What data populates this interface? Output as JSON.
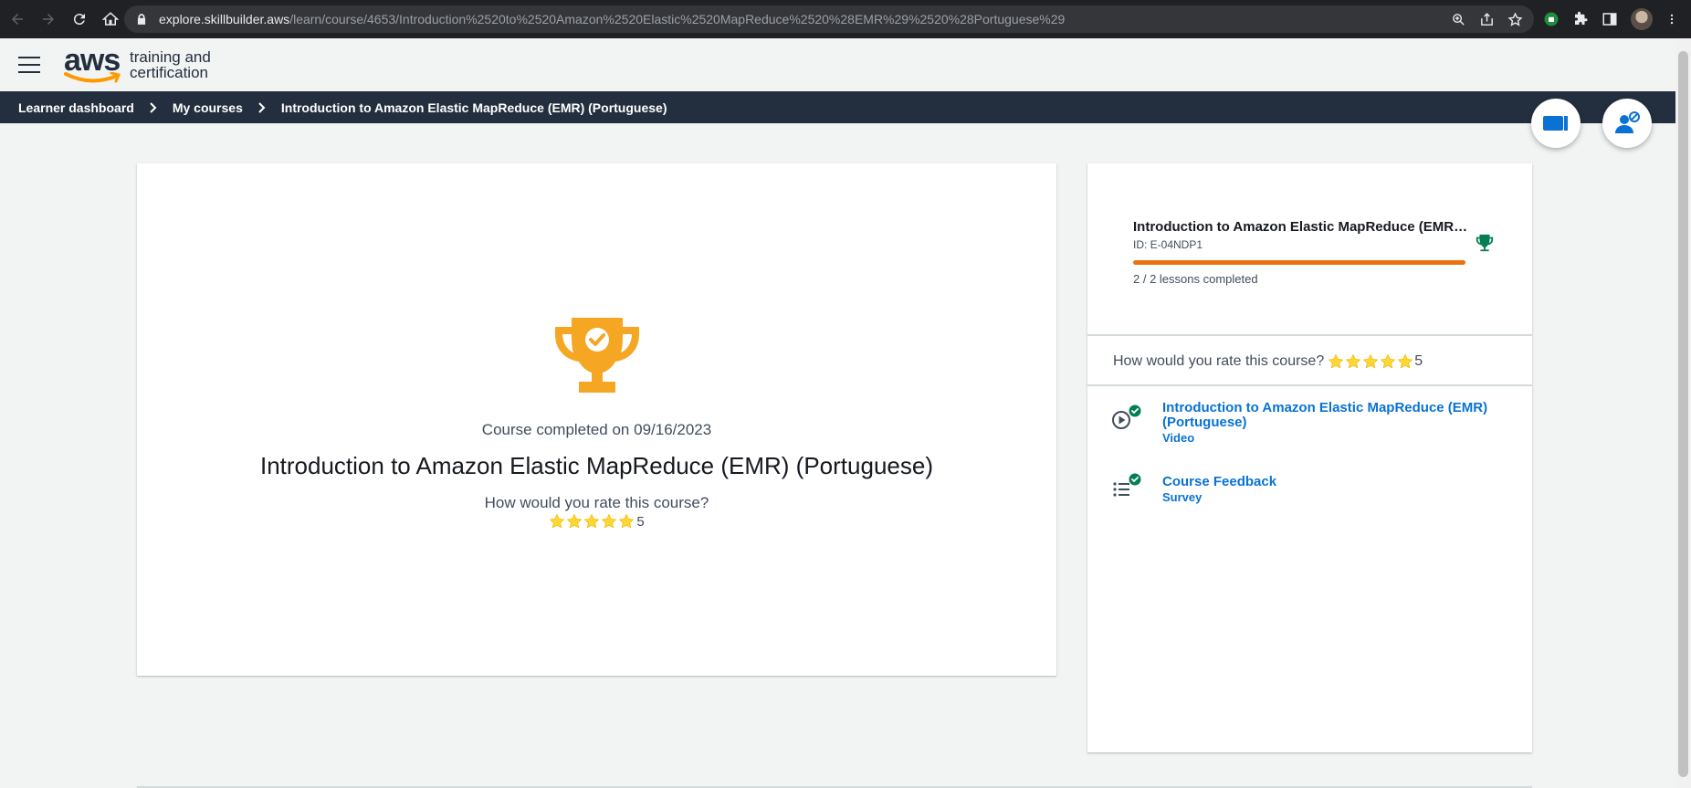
{
  "browser": {
    "url_host": "explore.skillbuilder.aws",
    "url_path": "/learn/course/4653/Introduction%2520to%2520Amazon%2520Elastic%2520MapReduce%2520%28EMR%29%2520%28Portuguese%29",
    "icons": [
      "back-icon",
      "forward-icon",
      "reload-icon",
      "home-icon",
      "lock-icon",
      "zoom-icon",
      "share-icon",
      "star-icon",
      "extension-icon",
      "puzzle-icon",
      "sidepanel-icon",
      "avatar",
      "more-icon"
    ]
  },
  "header": {
    "logo_word": "aws",
    "logo_line1": "training and",
    "logo_line2": "certification",
    "brand_color": "#232f3e",
    "smile_color": "#ff9900"
  },
  "breadcrumb": {
    "items": [
      "Learner dashboard",
      "My courses",
      "Introduction to Amazon Elastic MapReduce (EMR) (Portuguese)"
    ]
  },
  "fabs": [
    "video-icon",
    "accessibility-user-icon"
  ],
  "main": {
    "completed_on": "Course completed on 09/16/2023",
    "title": "Introduction to Amazon Elastic MapReduce (EMR) (Portuguese)",
    "rate_question": "How would you rate this course?",
    "stars": 5,
    "rating": "5",
    "trophy_color": "#f5a623"
  },
  "side": {
    "title": "Introduction to Amazon Elastic MapReduce (EMR) (Portuguese)",
    "course_id": "ID: E-04NDP1",
    "progress_fraction": 1.0,
    "progress_color": "#ec7211",
    "lessons_completed": "2 / 2 lessons completed",
    "rate_question": "How would you rate this course?",
    "rating": "5",
    "trophy_color": "#037f51",
    "lessons": [
      {
        "title": "Introduction to Amazon Elastic MapReduce (EMR) (Portuguese)",
        "type": "Video",
        "icon": "play-circle-icon",
        "completed": true
      },
      {
        "title": "Course Feedback",
        "type": "Survey",
        "icon": "list-icon",
        "completed": true
      }
    ]
  }
}
